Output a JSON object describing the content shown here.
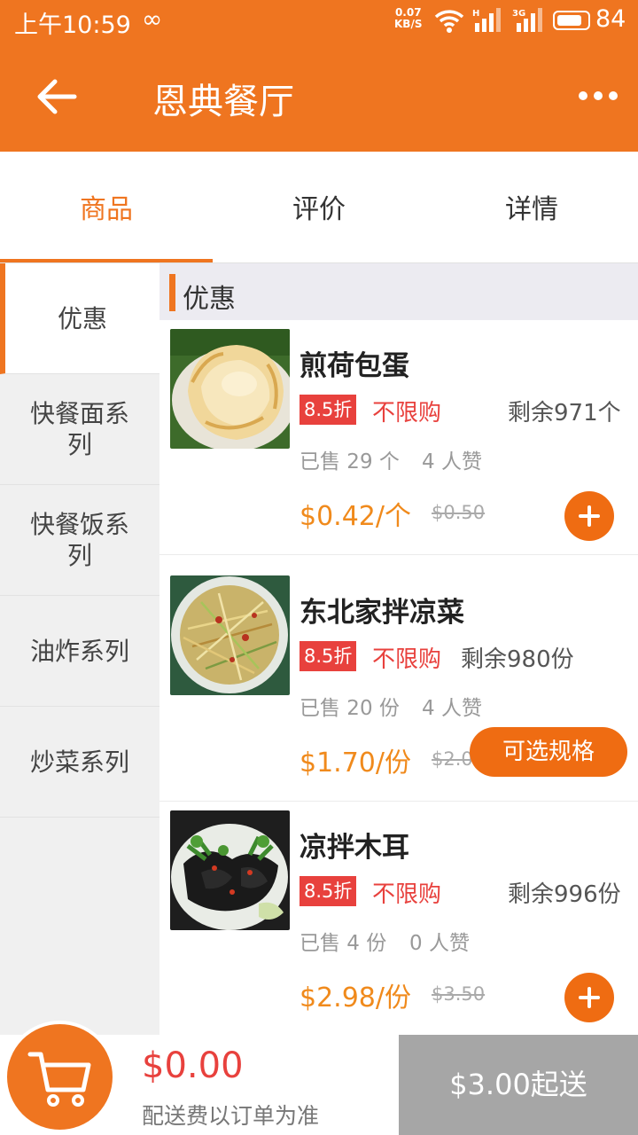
{
  "status_bar": {
    "time": "上午10:59",
    "loop_symbol": "∞",
    "net_speed_value": "0.07",
    "net_speed_unit": "KB/S",
    "battery": "84"
  },
  "app_bar": {
    "title": "恩典餐厅",
    "back_icon": "arrow-left-icon",
    "more_icon": "more-dots-icon"
  },
  "tabs": [
    {
      "label": "商品",
      "active": true
    },
    {
      "label": "评价",
      "active": false
    },
    {
      "label": "详情",
      "active": false
    }
  ],
  "categories": [
    {
      "label": "优惠",
      "active": true
    },
    {
      "label": "快餐面系列",
      "active": false
    },
    {
      "label": "快餐饭系列",
      "active": false
    },
    {
      "label": "油炸系列",
      "active": false
    },
    {
      "label": "炒菜系列",
      "active": false
    }
  ],
  "section_title": "优惠",
  "items": [
    {
      "name": "煎荷包蛋",
      "discount": "8.5折",
      "limit": "不限购",
      "stock": "剩余971个",
      "sold": "已售 29 个",
      "likes": "4 人赞",
      "price": "$0.42/个",
      "old_price": "$0.50",
      "action": "add-icon"
    },
    {
      "name": "东北家拌凉菜",
      "discount": "8.5折",
      "limit": "不限购",
      "stock": "剩余980份",
      "sold": "已售 20 份",
      "likes": "4 人赞",
      "price": "$1.70/份",
      "old_price": "$2.00",
      "action_label": "可选规格"
    },
    {
      "name": "凉拌木耳",
      "discount": "8.5折",
      "limit": "不限购",
      "stock": "剩余996份",
      "sold": "已售 4 份",
      "likes": "0 人赞",
      "price": "$2.98/份",
      "old_price": "$3.50",
      "action": "add-icon"
    }
  ],
  "cart": {
    "icon": "shopping-cart-icon",
    "total": "$0.00",
    "note": "配送费以订单为准",
    "checkout_label": "$3.00起送"
  },
  "colors": {
    "brand": "#ef7520",
    "discount_red": "#e8413d",
    "price_orange": "#f08a1c",
    "checkout_disabled": "#a6a6a6"
  }
}
